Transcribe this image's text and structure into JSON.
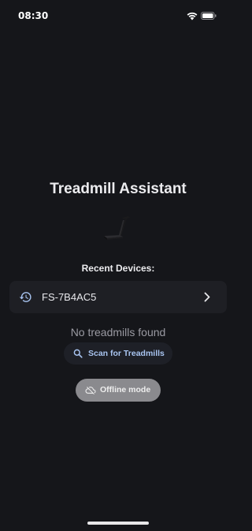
{
  "status_bar": {
    "time": "08:30",
    "icons": [
      "wifi-icon",
      "battery-icon"
    ]
  },
  "title": "Treadmill Assistant",
  "hero_icon": "treadmill-icon",
  "recent_devices": {
    "heading": "Recent Devices:",
    "items": [
      {
        "label": "FS-7B4AC5",
        "icon": "history-icon",
        "trailing_icon": "chevron-right-icon"
      }
    ]
  },
  "scan": {
    "empty_message": "No treadmills found",
    "button_label": "Scan for Treadmills",
    "icon": "search-icon"
  },
  "offline": {
    "button_label": "Offline mode",
    "icon": "cloud-off-icon"
  },
  "colors": {
    "background": "#15161a",
    "card": "#1e1f24",
    "accent": "#a8c4f0",
    "muted_text": "#9a9aa2",
    "offline_button": "#8a8a8e"
  }
}
